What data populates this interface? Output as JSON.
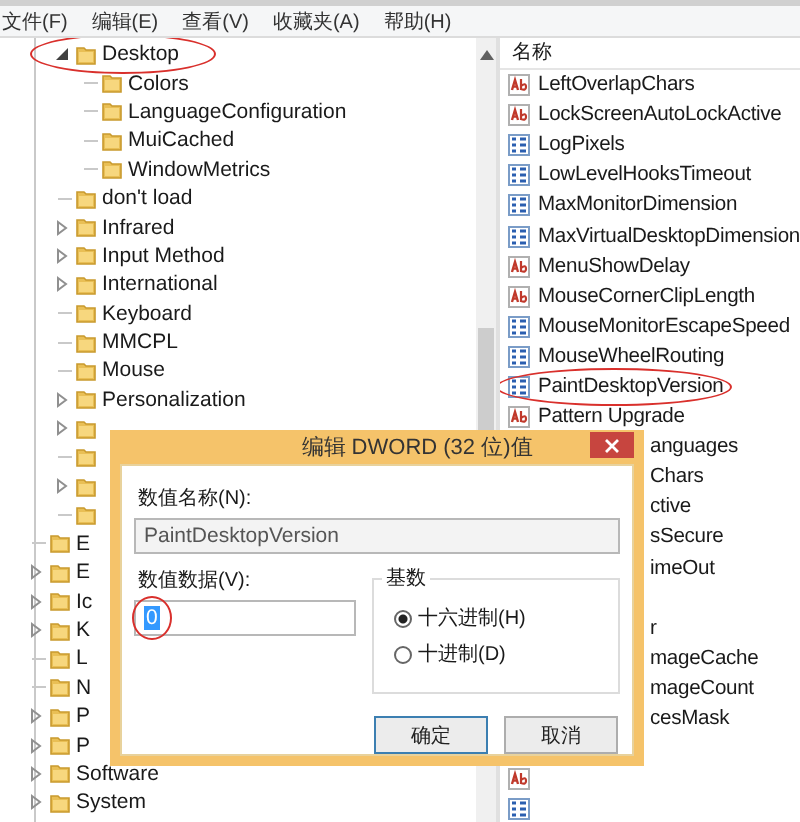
{
  "menu": [
    "文件(F)",
    "编辑(E)",
    "查看(V)",
    "收藏夹(A)",
    "帮助(H)"
  ],
  "tree": {
    "items": [
      {
        "children": [
          {
            "label": "Desktop",
            "expandable": true,
            "expanded": true,
            "circled": true,
            "children": [
              {
                "label": "Colors",
                "expandable": false
              },
              {
                "label": "LanguageConfiguration",
                "expandable": false
              },
              {
                "label": "MuiCached",
                "expandable": false
              },
              {
                "label": "WindowMetrics",
                "expandable": false
              }
            ]
          },
          {
            "label": "don't load",
            "expandable": false
          },
          {
            "label": "Infrared",
            "expandable": true,
            "expanded": false
          },
          {
            "label": "Input Method",
            "expandable": true,
            "expanded": false
          },
          {
            "label": "International",
            "expandable": true,
            "expanded": false
          },
          {
            "label": "Keyboard",
            "expandable": false
          },
          {
            "label": "MMCPL",
            "expandable": false
          },
          {
            "label": "Mouse",
            "expandable": false
          },
          {
            "label": "Personalization",
            "expandable": true,
            "expanded": false
          },
          {
            "expandable": true,
            "expanded": false
          },
          {
            "expandable": false
          },
          {
            "expandable": true,
            "expanded": false
          },
          {
            "expandable": false
          }
        ]
      },
      {
        "label": "E",
        "expandable": false
      },
      {
        "label": "E",
        "expandable": true,
        "expanded": false
      },
      {
        "label": "Ic",
        "expandable": true,
        "expanded": false
      },
      {
        "label": "K",
        "expandable": true,
        "expanded": false
      },
      {
        "label": "L",
        "expandable": false
      },
      {
        "label": "N",
        "expandable": false
      },
      {
        "label": "P",
        "expandable": true,
        "expanded": false
      },
      {
        "label": "P",
        "expandable": true,
        "expanded": false
      },
      {
        "label": "Software",
        "expandable": true,
        "expanded": false
      },
      {
        "label": "System",
        "expandable": true,
        "expanded": false
      }
    ]
  },
  "values": {
    "column": "名称",
    "rows": [
      {
        "kind": "string",
        "name": "LeftOverlapChars"
      },
      {
        "kind": "string",
        "name": "LockScreenAutoLockActive"
      },
      {
        "kind": "dword",
        "name": "LogPixels"
      },
      {
        "kind": "dword",
        "name": "LowLevelHooksTimeout"
      },
      {
        "kind": "dword",
        "name": "MaxMonitorDimension"
      },
      {
        "kind": "dword",
        "name": "MaxVirtualDesktopDimension"
      },
      {
        "kind": "string",
        "name": "MenuShowDelay"
      },
      {
        "kind": "string",
        "name": "MouseCornerClipLength"
      },
      {
        "kind": "dword",
        "name": "MouseMonitorEscapeSpeed"
      },
      {
        "kind": "dword",
        "name": "MouseWheelRouting"
      },
      {
        "kind": "dword",
        "name": "PaintDesktopVersion",
        "circled": true
      },
      {
        "kind": "string",
        "name": "Pattern Upgrade"
      },
      {
        "kind": "partial",
        "name": "anguages"
      },
      {
        "kind": "partial",
        "name": "Chars"
      },
      {
        "kind": "partial",
        "name": "ctive"
      },
      {
        "kind": "partial",
        "name": "sSecure"
      },
      {
        "kind": "partial",
        "name": "imeOut"
      },
      {
        "kind": "covered"
      },
      {
        "kind": "partial",
        "name": "r"
      },
      {
        "kind": "partial",
        "name": "mageCache"
      },
      {
        "kind": "partial",
        "name": "mageCount"
      },
      {
        "kind": "partial",
        "name": "cesMask"
      },
      {
        "kind": "covered"
      },
      {
        "kind": "string"
      },
      {
        "kind": "dword"
      }
    ]
  },
  "dialog": {
    "title": "编辑 DWORD (32 位)值",
    "name_label": "数值名称(N):",
    "name_value": "PaintDesktopVersion",
    "data_label": "数值数据(V):",
    "data_value": "0",
    "data_selected": true,
    "data_circled": true,
    "base": {
      "label": "基数",
      "options": [
        {
          "label": "十六进制(H)",
          "selected": true
        },
        {
          "label": "十进制(D)",
          "selected": false
        }
      ]
    },
    "buttons": [
      "确定",
      "取消"
    ]
  }
}
